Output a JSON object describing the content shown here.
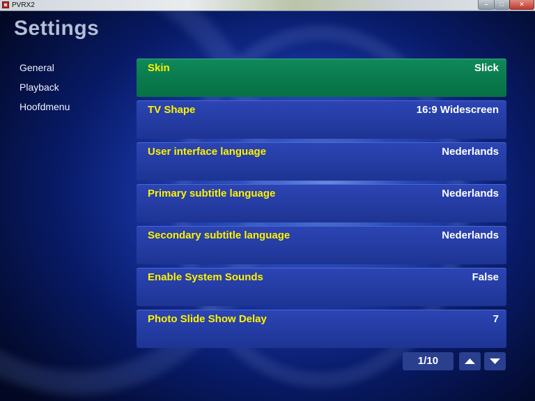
{
  "window": {
    "title": "PVRX2"
  },
  "page": {
    "title": "Settings"
  },
  "sidebar": {
    "items": [
      {
        "label": "General"
      },
      {
        "label": "Playback"
      },
      {
        "label": "Hoofdmenu"
      }
    ]
  },
  "settings": [
    {
      "label": "Skin",
      "value": "Slick",
      "selected": true
    },
    {
      "label": "TV Shape",
      "value": "16:9 Widescreen"
    },
    {
      "label": "User interface language",
      "value": "Nederlands"
    },
    {
      "label": "Primary subtitle language",
      "value": "Nederlands"
    },
    {
      "label": "Secondary subtitle language",
      "value": "Nederlands"
    },
    {
      "label": "Enable System Sounds",
      "value": "False"
    },
    {
      "label": "Photo Slide Show Delay",
      "value": "7"
    }
  ],
  "pager": {
    "text": "1/10"
  },
  "colors": {
    "label": "#fff200",
    "selected_row": "#0a7a4d",
    "row": "#243da4",
    "background": "#0a1d72"
  }
}
